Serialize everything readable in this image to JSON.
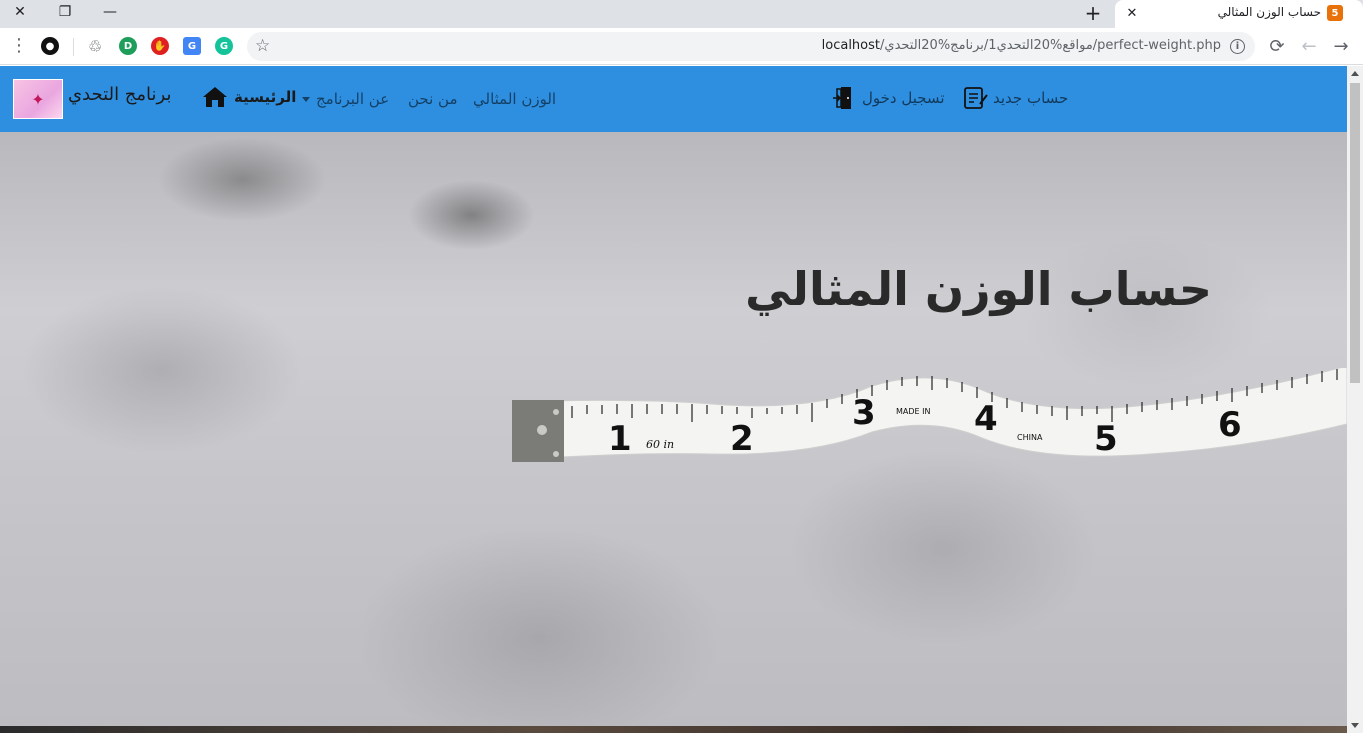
{
  "browser": {
    "tab": {
      "title": "حساب الوزن المثالي",
      "favicon": "html-icon"
    },
    "window_controls": {
      "close": "✕",
      "restore": "❐",
      "minimize": "—"
    },
    "new_tab_label": "+",
    "tab_close_label": "✕",
    "address_bar": {
      "host": "localhost",
      "path": "/مواقع%20التحدي1/برنامج%20التحدي/perfect-weight.php"
    }
  },
  "navbar": {
    "brand": "برنامج التحدي",
    "home": "الرئيسية",
    "about_program": "عن البرنامج",
    "about_us": "من نحن",
    "perfect_weight": "الوزن المثالي",
    "login": "تسجيل دخول",
    "register": "حساب جديد",
    "bg_color": "#2e8fe1"
  },
  "hero": {
    "title": "حساب الوزن المثالي",
    "tape_numbers": [
      "1",
      "2",
      "3",
      "4",
      "5",
      "6"
    ],
    "tape_text": {
      "unit": "60 in",
      "made_in": "MADE IN",
      "china": "CHINA"
    }
  }
}
